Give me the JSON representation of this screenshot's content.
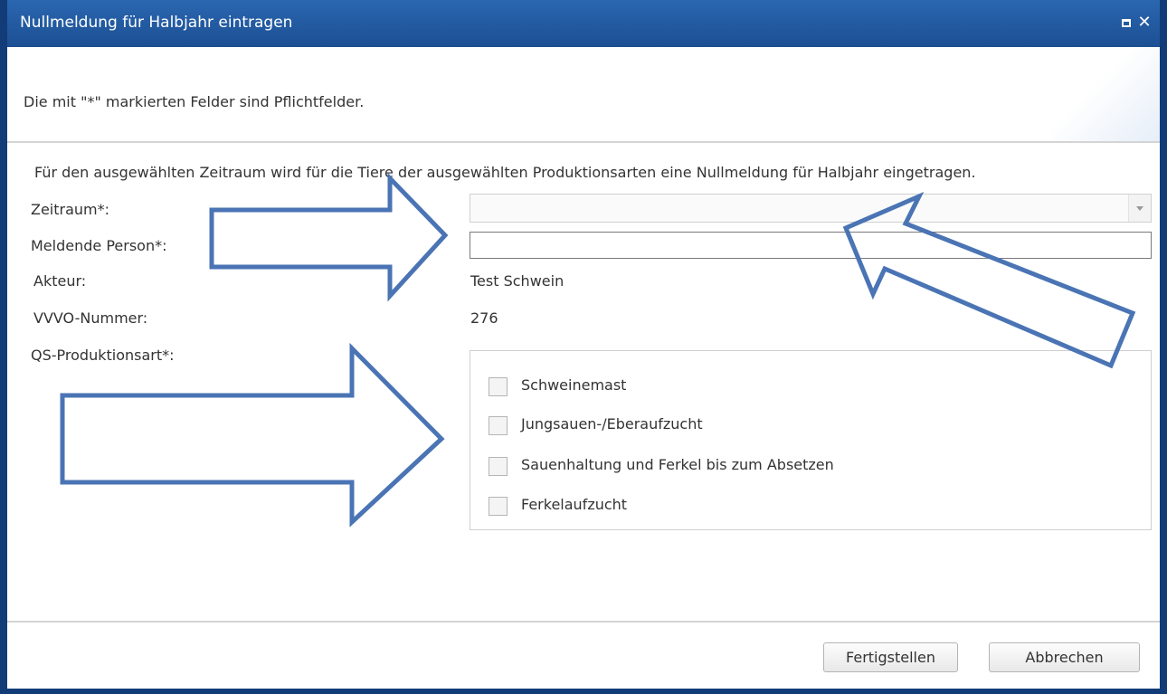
{
  "window": {
    "title": "Nullmeldung für Halbjahr eintragen"
  },
  "header": {
    "required_note": "Die mit \"*\" markierten Felder sind Pflichtfelder."
  },
  "form": {
    "info_text": "Für den ausgewählten Zeitraum wird für die Tiere der ausgewählten Produktionsarten eine Nullmeldung für Halbjahr eingetragen.",
    "zeitraum": {
      "label": "Zeitraum*:",
      "value": ""
    },
    "meldende_person": {
      "label": "Meldende Person*:",
      "value": ""
    },
    "akteur": {
      "label": "Akteur:",
      "value": "Test Schwein"
    },
    "vvvo": {
      "label": "VVVO-Nummer:",
      "value": "276"
    },
    "produktionsart": {
      "label": "QS-Produktionsart*:",
      "options": [
        {
          "label": "Schweinemast",
          "checked": false
        },
        {
          "label": "Jungsauen-/Eberaufzucht",
          "checked": false
        },
        {
          "label": "Sauenhaltung und Ferkel bis zum Absetzen",
          "checked": false
        },
        {
          "label": "Ferkelaufzucht",
          "checked": false
        }
      ]
    }
  },
  "footer": {
    "finish_label": "Fertigstellen",
    "cancel_label": "Abbrechen"
  },
  "colors": {
    "titlebar": "#1c4f93",
    "window_border": "#123c78",
    "annotation_arrow": "#4a74b4"
  },
  "icons": {
    "maximize": "maximize-icon",
    "close": "close-icon",
    "dropdown": "chevron-down-icon",
    "annotation": "arrow-annotation"
  }
}
